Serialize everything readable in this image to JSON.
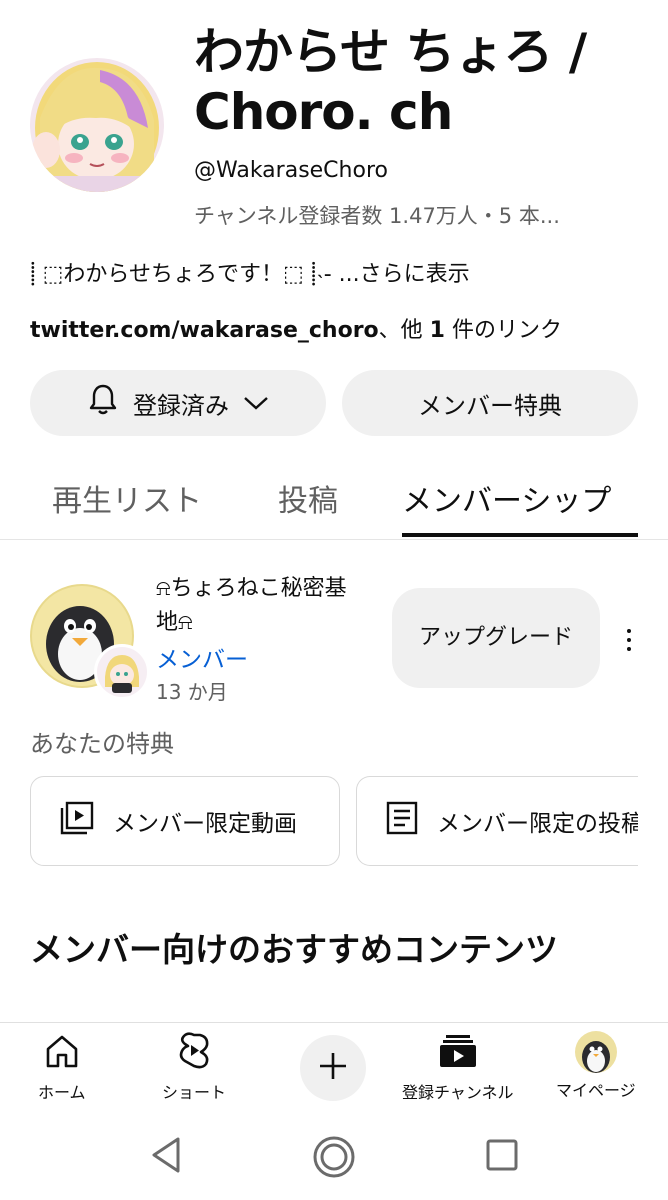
{
  "channel": {
    "title": "わからせ ちょろ / Choro. ch",
    "handle": "@WakaraseChoro",
    "stats": "チャンネル登録者数 1.47万人・5 本...",
    "description": "⸽ ⬚わからせちょろです！⬚ ⸽˴- ...さらに表示",
    "links_main": "twitter.com/wakarase_choro",
    "links_sep": "、他 ",
    "links_count": "1",
    "links_suffix": " 件のリンク"
  },
  "actions": {
    "subscribed_label": "登録済み",
    "member_perks_label": "メンバー特典"
  },
  "tabs": [
    {
      "label": "再生リスト",
      "active": false
    },
    {
      "label": "投稿",
      "active": false
    },
    {
      "label": "メンバーシップ",
      "active": true
    }
  ],
  "membership": {
    "name": "⍾ちょろねこ秘密基地⍾",
    "status": "メンバー",
    "duration": "13 か月",
    "upgrade_label": "アップグレード",
    "perks_heading": "あなたの特典",
    "perks": [
      {
        "label": "メンバー限定動画",
        "icon": "video-library-icon"
      },
      {
        "label": "メンバー限定の投稿",
        "icon": "post-icon"
      }
    ]
  },
  "recommended_heading": "メンバー向けのおすすめコンテンツ",
  "bottom_nav": {
    "home": "ホーム",
    "shorts": "ショート",
    "subscriptions": "登録チャンネル",
    "mypage": "マイページ"
  },
  "colors": {
    "link_blue": "#065fd4",
    "pill_bg": "#f0f0f0",
    "secondary_text": "#606060"
  }
}
